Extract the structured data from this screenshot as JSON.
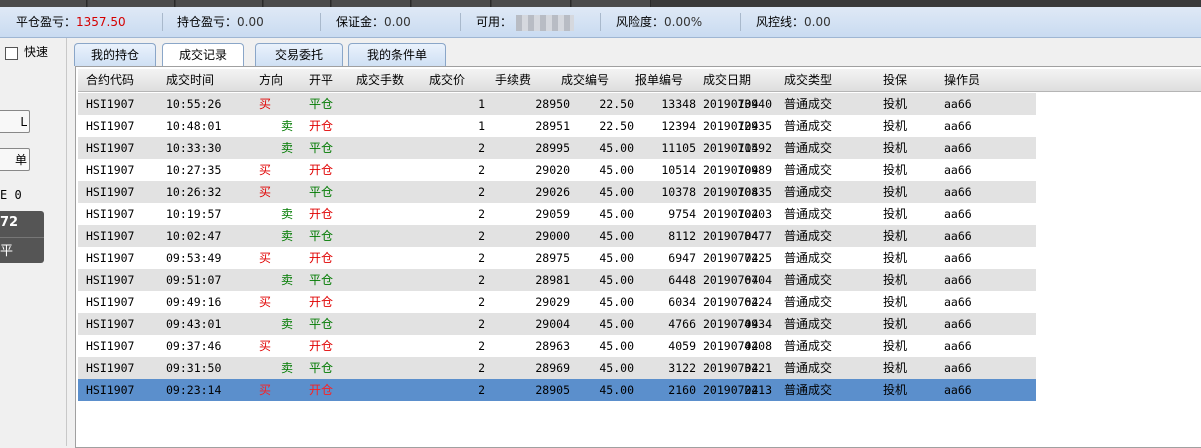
{
  "summary": {
    "close_pnl_label": "平仓盈亏：",
    "close_pnl_value": "1357.50",
    "hold_pnl_label": "持仓盈亏：",
    "hold_pnl_value": "0.00",
    "margin_label": "保证金：",
    "margin_value": "0.00",
    "available_label": "可用：",
    "risk_label": "风险度：",
    "risk_value": "0.00%",
    "control_label": "风控线：",
    "control_value": "0.00",
    "accent_red": "#d40000"
  },
  "left_panel": {
    "quick_label": "快速",
    "button1_label": "L",
    "button2_label": "单",
    "text_row": "E 0",
    "dark_top": "72",
    "dark_bottom": "平"
  },
  "tabs": [
    {
      "label": "我的持仓",
      "active": false
    },
    {
      "label": "成交记录",
      "active": true
    },
    {
      "label": "交易委托",
      "active": false
    },
    {
      "label": "我的条件单",
      "active": false
    }
  ],
  "columns": [
    "合约代码",
    "成交时间",
    "方向",
    "开平",
    "成交手数",
    "成交价",
    "手续费",
    "成交编号",
    "报单编号",
    "成交日期",
    "成交类型",
    "投保",
    "操作员"
  ],
  "rows": [
    {
      "contract": "HSI1907",
      "time": "10:55:26",
      "dir": "买",
      "dir_type": "buy",
      "oc": "平仓",
      "qty": "1",
      "price": "28950",
      "fee": "22.50",
      "trade_no": "13348",
      "order_no": "13940",
      "date": "20190704",
      "type": "普通成交",
      "hedge": "投机",
      "operator": "aa66"
    },
    {
      "contract": "HSI1907",
      "time": "10:48:01",
      "dir": "卖",
      "dir_type": "sell",
      "oc": "开仓",
      "qty": "1",
      "price": "28951",
      "fee": "22.50",
      "trade_no": "12394",
      "order_no": "12935",
      "date": "20190704",
      "type": "普通成交",
      "hedge": "投机",
      "operator": "aa66"
    },
    {
      "contract": "HSI1907",
      "time": "10:33:30",
      "dir": "卖",
      "dir_type": "sell",
      "oc": "平仓",
      "qty": "2",
      "price": "28995",
      "fee": "45.00",
      "trade_no": "11105",
      "order_no": "11592",
      "date": "20190704",
      "type": "普通成交",
      "hedge": "投机",
      "operator": "aa66"
    },
    {
      "contract": "HSI1907",
      "time": "10:27:35",
      "dir": "买",
      "dir_type": "buy",
      "oc": "开仓",
      "qty": "2",
      "price": "29020",
      "fee": "45.00",
      "trade_no": "10514",
      "order_no": "10989",
      "date": "20190704",
      "type": "普通成交",
      "hedge": "投机",
      "operator": "aa66"
    },
    {
      "contract": "HSI1907",
      "time": "10:26:32",
      "dir": "买",
      "dir_type": "buy",
      "oc": "平仓",
      "qty": "2",
      "price": "29026",
      "fee": "45.00",
      "trade_no": "10378",
      "order_no": "10835",
      "date": "20190704",
      "type": "普通成交",
      "hedge": "投机",
      "operator": "aa66"
    },
    {
      "contract": "HSI1907",
      "time": "10:19:57",
      "dir": "卖",
      "dir_type": "sell",
      "oc": "开仓",
      "qty": "2",
      "price": "29059",
      "fee": "45.00",
      "trade_no": "9754",
      "order_no": "10203",
      "date": "20190704",
      "type": "普通成交",
      "hedge": "投机",
      "operator": "aa66"
    },
    {
      "contract": "HSI1907",
      "time": "10:02:47",
      "dir": "卖",
      "dir_type": "sell",
      "oc": "平仓",
      "qty": "2",
      "price": "29000",
      "fee": "45.00",
      "trade_no": "8112",
      "order_no": "8477",
      "date": "20190704",
      "type": "普通成交",
      "hedge": "投机",
      "operator": "aa66"
    },
    {
      "contract": "HSI1907",
      "time": "09:53:49",
      "dir": "买",
      "dir_type": "buy",
      "oc": "开仓",
      "qty": "2",
      "price": "28975",
      "fee": "45.00",
      "trade_no": "6947",
      "order_no": "7225",
      "date": "20190704",
      "type": "普通成交",
      "hedge": "投机",
      "operator": "aa66"
    },
    {
      "contract": "HSI1907",
      "time": "09:51:07",
      "dir": "卖",
      "dir_type": "sell",
      "oc": "平仓",
      "qty": "2",
      "price": "28981",
      "fee": "45.00",
      "trade_no": "6448",
      "order_no": "6704",
      "date": "20190704",
      "type": "普通成交",
      "hedge": "投机",
      "operator": "aa66"
    },
    {
      "contract": "HSI1907",
      "time": "09:49:16",
      "dir": "买",
      "dir_type": "buy",
      "oc": "开仓",
      "qty": "2",
      "price": "29029",
      "fee": "45.00",
      "trade_no": "6034",
      "order_no": "6224",
      "date": "20190704",
      "type": "普通成交",
      "hedge": "投机",
      "operator": "aa66"
    },
    {
      "contract": "HSI1907",
      "time": "09:43:01",
      "dir": "卖",
      "dir_type": "sell",
      "oc": "平仓",
      "qty": "2",
      "price": "29004",
      "fee": "45.00",
      "trade_no": "4766",
      "order_no": "4934",
      "date": "20190704",
      "type": "普通成交",
      "hedge": "投机",
      "operator": "aa66"
    },
    {
      "contract": "HSI1907",
      "time": "09:37:46",
      "dir": "买",
      "dir_type": "buy",
      "oc": "开仓",
      "qty": "2",
      "price": "28963",
      "fee": "45.00",
      "trade_no": "4059",
      "order_no": "4208",
      "date": "20190704",
      "type": "普通成交",
      "hedge": "投机",
      "operator": "aa66"
    },
    {
      "contract": "HSI1907",
      "time": "09:31:50",
      "dir": "卖",
      "dir_type": "sell",
      "oc": "平仓",
      "qty": "2",
      "price": "28969",
      "fee": "45.00",
      "trade_no": "3122",
      "order_no": "3221",
      "date": "20190704",
      "type": "普通成交",
      "hedge": "投机",
      "operator": "aa66"
    },
    {
      "contract": "HSI1907",
      "time": "09:23:14",
      "dir": "买",
      "dir_type": "buy",
      "oc": "开仓",
      "qty": "2",
      "price": "28905",
      "fee": "45.00",
      "trade_no": "2160",
      "order_no": "2213",
      "date": "20190704",
      "type": "普通成交",
      "hedge": "投机",
      "operator": "aa66",
      "selected": true
    }
  ],
  "colors": {
    "buy": "#e00000",
    "sell": "#007a00",
    "selected_row": "#5b8fcc",
    "alt_row": "#e2e2e2"
  }
}
